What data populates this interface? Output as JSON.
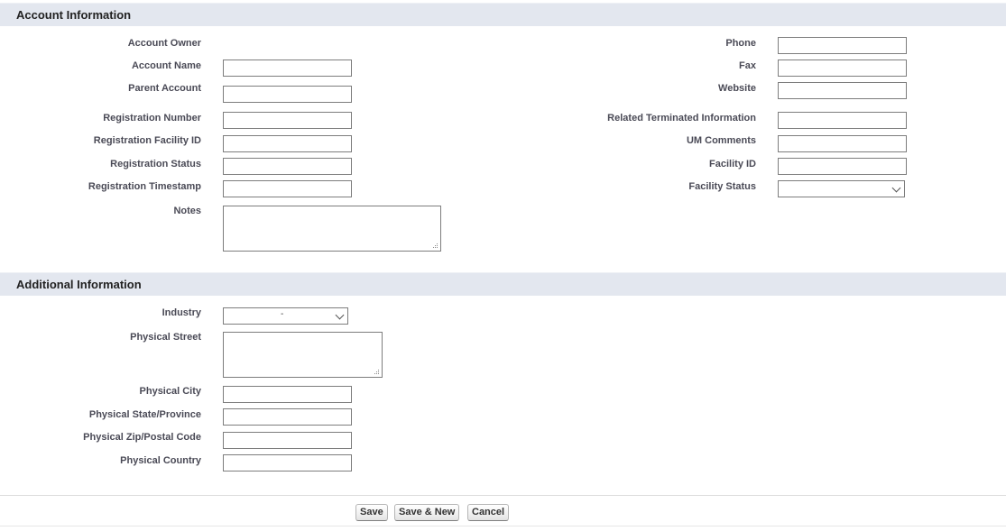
{
  "sections": {
    "account": {
      "title": "Account Information",
      "left_labels": {
        "owner": "Account Owner",
        "name": "Account Name",
        "parent": "Parent Account",
        "reg_number": "Registration Number",
        "reg_facility": "Registration Facility ID",
        "reg_status": "Registration Status",
        "reg_timestamp": "Registration Timestamp",
        "notes": "Notes"
      },
      "right_labels": {
        "phone": "Phone",
        "fax": "Fax",
        "website": "Website",
        "related_terminated": "Related Terminated Information",
        "um_comments": "UM Comments",
        "facility_id": "Facility ID",
        "facility_status": "Facility Status"
      },
      "values": {
        "owner": "",
        "name": "",
        "parent": "",
        "reg_number": "",
        "reg_facility": "",
        "reg_status": "",
        "reg_timestamp": "",
        "notes": "",
        "phone": "",
        "fax": "",
        "website": "",
        "related_terminated": "",
        "um_comments": "",
        "facility_id": "",
        "facility_status": ""
      }
    },
    "additional": {
      "title": "Additional Information",
      "labels": {
        "industry": "Industry",
        "street": "Physical Street",
        "city": "Physical City",
        "state": "Physical State/Province",
        "zip": "Physical Zip/Postal Code",
        "country": "Physical Country"
      },
      "values": {
        "industry": "-",
        "street": "",
        "city": "",
        "state": "",
        "zip": "",
        "country": ""
      }
    }
  },
  "buttons": {
    "save": "Save",
    "save_new": "Save & New",
    "cancel": "Cancel"
  },
  "icons": {
    "dropdown": "chevron-down-icon",
    "resize": "resize-grip-icon"
  },
  "colors": {
    "section_header_bg": "#e3e7ef",
    "label": "#4a4a56",
    "field_border": "#7d7d7d"
  }
}
